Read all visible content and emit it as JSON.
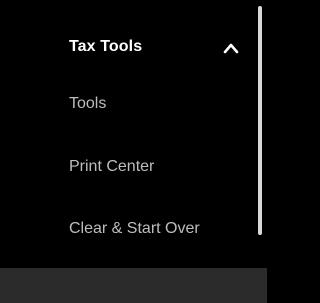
{
  "sidebar": {
    "section_title": "Tax Tools",
    "section_expanded": true,
    "items": [
      {
        "label": "Tools"
      },
      {
        "label": "Print Center"
      },
      {
        "label": "Clear & Start Over"
      }
    ]
  },
  "colors": {
    "background": "#000000",
    "header_text": "#ffffff",
    "item_text": "#bdbdbd",
    "scrollbar": "#d9d9d9",
    "footer_strip": "#2b2b2b"
  },
  "icons": {
    "toggle": "chevron-up-icon"
  }
}
